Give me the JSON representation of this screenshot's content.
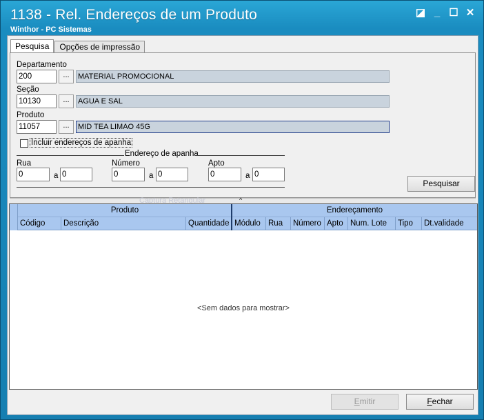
{
  "window": {
    "title": "1138 - Rel. Endereços de um Produto",
    "subtitle": "Winthor - PC Sistemas",
    "controls": {
      "restore": "◪",
      "minimize": "_",
      "maximize": "☐",
      "close": "✕"
    }
  },
  "tabs": [
    {
      "label": "Pesquisa",
      "active": true
    },
    {
      "label": "Opções de impressão",
      "active": false
    }
  ],
  "form": {
    "departamento": {
      "label": "Departamento",
      "code": "200",
      "desc": "MATERIAL PROMOCIONAL"
    },
    "secao": {
      "label": "Seção",
      "code": "10130",
      "desc": "AGUA E SAL"
    },
    "produto": {
      "label": "Produto",
      "code": "11057",
      "desc": "MID TEA LIMAO 45G"
    },
    "lookup_label": "...",
    "incluir_label": "Incluir endereços de apanha",
    "incluir_checked": false,
    "endereco_group": "Endereço de apanha",
    "range_sep": "a",
    "rua": {
      "label": "Rua",
      "from": "0",
      "to": "0"
    },
    "numero": {
      "label": "Número",
      "from": "0",
      "to": "0"
    },
    "apto": {
      "label": "Apto",
      "from": "0",
      "to": "0"
    },
    "pesquisar": "Pesquisar"
  },
  "splitter": {
    "ghost_text": "Captura Retangular",
    "arrow": "^"
  },
  "grid": {
    "bands": [
      "Produto",
      "Endereçamento"
    ],
    "columns": [
      "Código",
      "Descrição",
      "Quantidade",
      "Módulo",
      "Rua",
      "Número",
      "Apto",
      "Num. Lote",
      "Tipo",
      "Dt.validade"
    ],
    "empty_text": "<Sem dados para mostrar>"
  },
  "footer": {
    "emitir_pre": "",
    "emitir_ul": "E",
    "emitir_post": "mitir",
    "fechar_pre": "",
    "fechar_ul": "F",
    "fechar_post": "echar"
  },
  "colors": {
    "title_bar": "#1a8cc0",
    "grid_header": "#a9c7ef",
    "desc_field": "#c9d3dd"
  }
}
